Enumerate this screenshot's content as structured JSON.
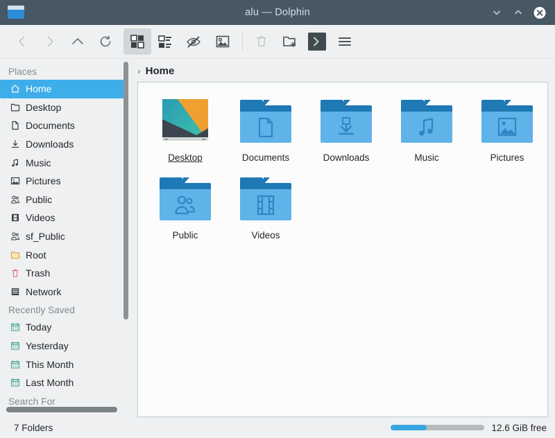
{
  "window": {
    "title": "alu — Dolphin",
    "app_icon": "folder-icon",
    "buttons": [
      {
        "name": "minimize-button",
        "icon": "chevron-down-icon"
      },
      {
        "name": "maximize-button",
        "icon": "chevron-up-icon"
      },
      {
        "name": "close-button",
        "icon": "close-icon"
      }
    ]
  },
  "toolbar": {
    "items": [
      {
        "name": "back-button",
        "icon": "chevron-left-icon",
        "state": "disabled"
      },
      {
        "name": "forward-button",
        "icon": "chevron-right-icon",
        "state": "disabled"
      },
      {
        "name": "up-button",
        "icon": "chevron-up-icon",
        "state": "enabled"
      },
      {
        "name": "reload-button",
        "icon": "reload-icon",
        "state": "enabled"
      },
      {
        "name": "icons-view-button",
        "icon": "grid-view-icon",
        "state": "active"
      },
      {
        "name": "details-view-button",
        "icon": "list-view-icon",
        "state": "enabled"
      },
      {
        "name": "hidden-files-button",
        "icon": "eye-slash-icon",
        "state": "enabled"
      },
      {
        "name": "preview-button",
        "icon": "image-preview-icon",
        "state": "enabled"
      },
      {
        "name": "trash-button",
        "icon": "trash-icon",
        "state": "disabled"
      },
      {
        "name": "new-folder-button",
        "icon": "new-folder-icon",
        "state": "enabled"
      },
      {
        "name": "terminal-button",
        "icon": "terminal-icon",
        "state": "enabled"
      },
      {
        "name": "menu-button",
        "icon": "hamburger-menu-icon",
        "state": "enabled"
      }
    ]
  },
  "sidebar": {
    "groups": [
      {
        "title": "Places",
        "items": [
          {
            "label": "Home",
            "icon": "home-icon",
            "selected": true
          },
          {
            "label": "Desktop",
            "icon": "desktop-folder-icon",
            "selected": false
          },
          {
            "label": "Documents",
            "icon": "documents-icon",
            "selected": false
          },
          {
            "label": "Downloads",
            "icon": "downloads-icon",
            "selected": false
          },
          {
            "label": "Music",
            "icon": "music-note-icon",
            "selected": false
          },
          {
            "label": "Pictures",
            "icon": "picture-icon",
            "selected": false
          },
          {
            "label": "Public",
            "icon": "people-icon",
            "selected": false
          },
          {
            "label": "Videos",
            "icon": "film-icon",
            "selected": false
          },
          {
            "label": "sf_Public",
            "icon": "people-icon",
            "selected": false
          },
          {
            "label": "Root",
            "icon": "root-folder-icon",
            "selected": false
          },
          {
            "label": "Trash",
            "icon": "trash-icon",
            "selected": false
          },
          {
            "label": "Network",
            "icon": "network-icon",
            "selected": false
          }
        ]
      },
      {
        "title": "Recently Saved",
        "items": [
          {
            "label": "Today",
            "icon": "calendar-icon",
            "selected": false
          },
          {
            "label": "Yesterday",
            "icon": "calendar-icon",
            "selected": false
          },
          {
            "label": "This Month",
            "icon": "calendar-icon",
            "selected": false
          },
          {
            "label": "Last Month",
            "icon": "calendar-icon",
            "selected": false
          }
        ]
      },
      {
        "title": "Search For",
        "items": []
      }
    ],
    "selected_color": "#3daee9"
  },
  "breadcrumb": {
    "arrow": "›",
    "current": "Home"
  },
  "files": {
    "items": [
      {
        "label": "Desktop",
        "icon": "desktop-wallpaper-thumbnail",
        "hovered": true
      },
      {
        "label": "Documents",
        "icon": "documents-folder-icon",
        "hovered": false
      },
      {
        "label": "Downloads",
        "icon": "downloads-folder-icon",
        "hovered": false
      },
      {
        "label": "Music",
        "icon": "music-folder-icon",
        "hovered": false
      },
      {
        "label": "Pictures",
        "icon": "pictures-folder-icon",
        "hovered": false
      },
      {
        "label": "Public",
        "icon": "public-folder-icon",
        "hovered": false
      },
      {
        "label": "Videos",
        "icon": "videos-folder-icon",
        "hovered": false
      }
    ]
  },
  "statusbar": {
    "count_text": "7 Folders",
    "free_text": "12.6 GiB free",
    "capacity_percent": 38,
    "capacity_color": "#36a6e0"
  }
}
